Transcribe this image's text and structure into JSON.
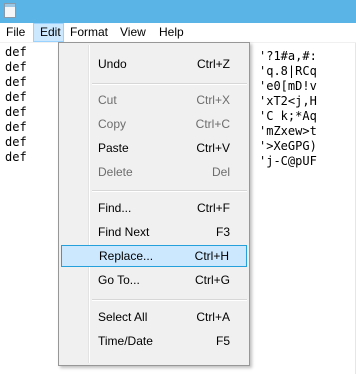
{
  "menubar": {
    "items": [
      {
        "label": "File"
      },
      {
        "label": "Edit"
      },
      {
        "label": "Format"
      },
      {
        "label": "View"
      },
      {
        "label": "Help"
      }
    ],
    "active": "Edit"
  },
  "editor": {
    "left_lines": [
      "def",
      "def",
      "def",
      "def",
      "def",
      "def",
      "def",
      "def"
    ],
    "right_lines": [
      "'?1#a,#:",
      "'q.8|RCq",
      "'e0[mD!v",
      "'xT2<j,H",
      "'C k;*Aq",
      "'mZxew>t",
      "'>XeGPG)",
      "'j-C@pUF"
    ]
  },
  "edit_menu": {
    "items": [
      {
        "label": "Undo",
        "shortcut": "Ctrl+Z",
        "disabled": false
      },
      {
        "label": "Cut",
        "shortcut": "Ctrl+X",
        "disabled": true
      },
      {
        "label": "Copy",
        "shortcut": "Ctrl+C",
        "disabled": true
      },
      {
        "label": "Paste",
        "shortcut": "Ctrl+V",
        "disabled": false
      },
      {
        "label": "Delete",
        "shortcut": "Del",
        "disabled": true
      },
      {
        "label": "Find...",
        "shortcut": "Ctrl+F",
        "disabled": false
      },
      {
        "label": "Find Next",
        "shortcut": "F3",
        "disabled": false
      },
      {
        "label": "Replace...",
        "shortcut": "Ctrl+H",
        "disabled": false,
        "selected": true
      },
      {
        "label": "Go To...",
        "shortcut": "Ctrl+G",
        "disabled": false
      },
      {
        "label": "Select All",
        "shortcut": "Ctrl+A",
        "disabled": false
      },
      {
        "label": "Time/Date",
        "shortcut": "F5",
        "disabled": false
      }
    ]
  },
  "colors": {
    "titlebar": "#5ab4e6",
    "menu_highlight": "#cce8ff",
    "menu_highlight_border": "#99d1ff",
    "disabled_text": "#6d6d6d"
  },
  "icons": {
    "app": "notepad-icon"
  }
}
